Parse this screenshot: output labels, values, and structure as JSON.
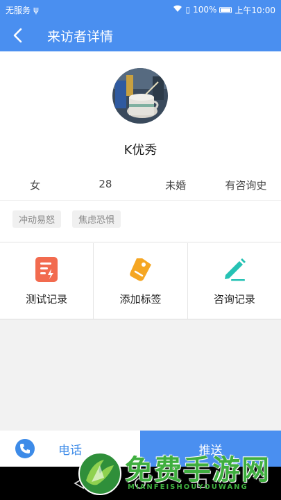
{
  "status_bar": {
    "carrier": "无服务",
    "battery": "100%",
    "time": "上午10:00"
  },
  "header": {
    "title": "来访者详情"
  },
  "profile": {
    "name": "K优秀",
    "gender": "女",
    "age": "28",
    "marital_status": "未婚",
    "consult_history": "有咨询史",
    "tags": [
      "冲动易怒",
      "焦虑恐惧"
    ]
  },
  "actions": [
    {
      "label": "测试记录",
      "icon": "test-record-icon",
      "color": "#f26b4f"
    },
    {
      "label": "添加标签",
      "icon": "tag-icon",
      "color": "#f5a623"
    },
    {
      "label": "咨询记录",
      "icon": "edit-pen-icon",
      "color": "#26c2b4"
    }
  ],
  "bottom": {
    "call_label": "电话",
    "push_label": "推送"
  },
  "watermark": {
    "text": "免费手游网",
    "sub": "MIANFEISHOUYOUWANG"
  },
  "colors": {
    "primary": "#4a8ff0",
    "watermark": "#3fae3f"
  }
}
